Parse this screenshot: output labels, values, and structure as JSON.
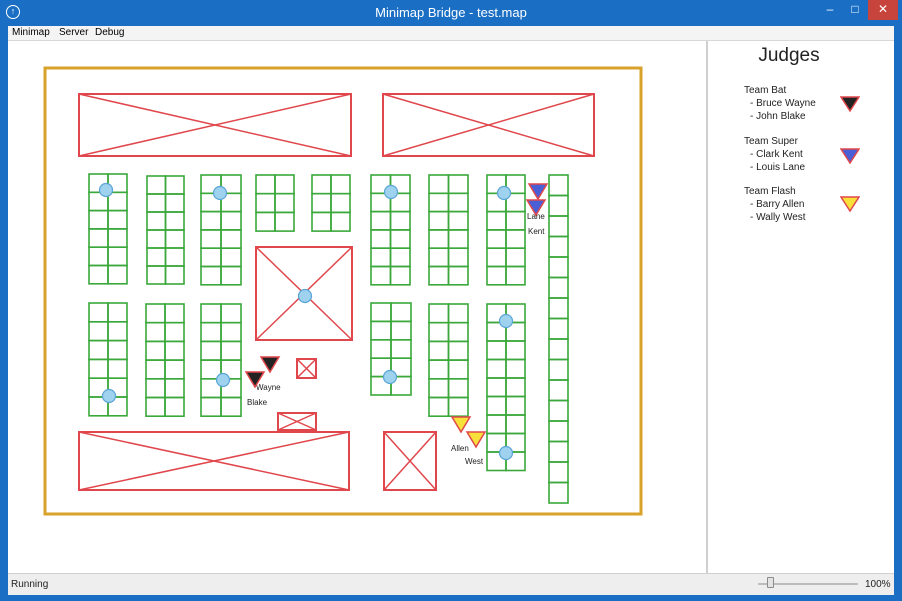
{
  "window": {
    "title": "Minimap Bridge - test.map",
    "app_icon": "circle-logo-icon",
    "controls": {
      "minimize": "–",
      "maximize": "□",
      "close": "✕"
    }
  },
  "menu": {
    "items": [
      "Minimap",
      "Server",
      "Debug"
    ]
  },
  "legend": {
    "heading": "Judges",
    "teams": [
      {
        "name": "Team Bat",
        "members": [
          "- Bruce Wayne",
          "- John Blake"
        ],
        "color": "#222222"
      },
      {
        "name": "Team Super",
        "members": [
          "- Clark Kent",
          "- Louis Lane"
        ],
        "color": "#4a5fd6"
      },
      {
        "name": "Team Flash",
        "members": [
          "- Barry Allen",
          "- Wally West"
        ],
        "color": "#f7e03a"
      }
    ]
  },
  "map": {
    "judges": [
      {
        "label": "Wayne",
        "team": 0
      },
      {
        "label": "Blake",
        "team": 0
      },
      {
        "label": "Lane",
        "team": 1
      },
      {
        "label": "Kent",
        "team": 1
      },
      {
        "label": "Allen",
        "team": 2
      },
      {
        "label": "West",
        "team": 2
      }
    ],
    "colors": {
      "boundary": "#d9a22a",
      "blocked": "#e0474c",
      "table": "#3aa83a",
      "marker": "#9ed2ee",
      "marker_stroke": "#5aa5d6"
    }
  },
  "status": {
    "text": "Running",
    "zoom_label": "100%",
    "zoom_level": 0.12
  }
}
